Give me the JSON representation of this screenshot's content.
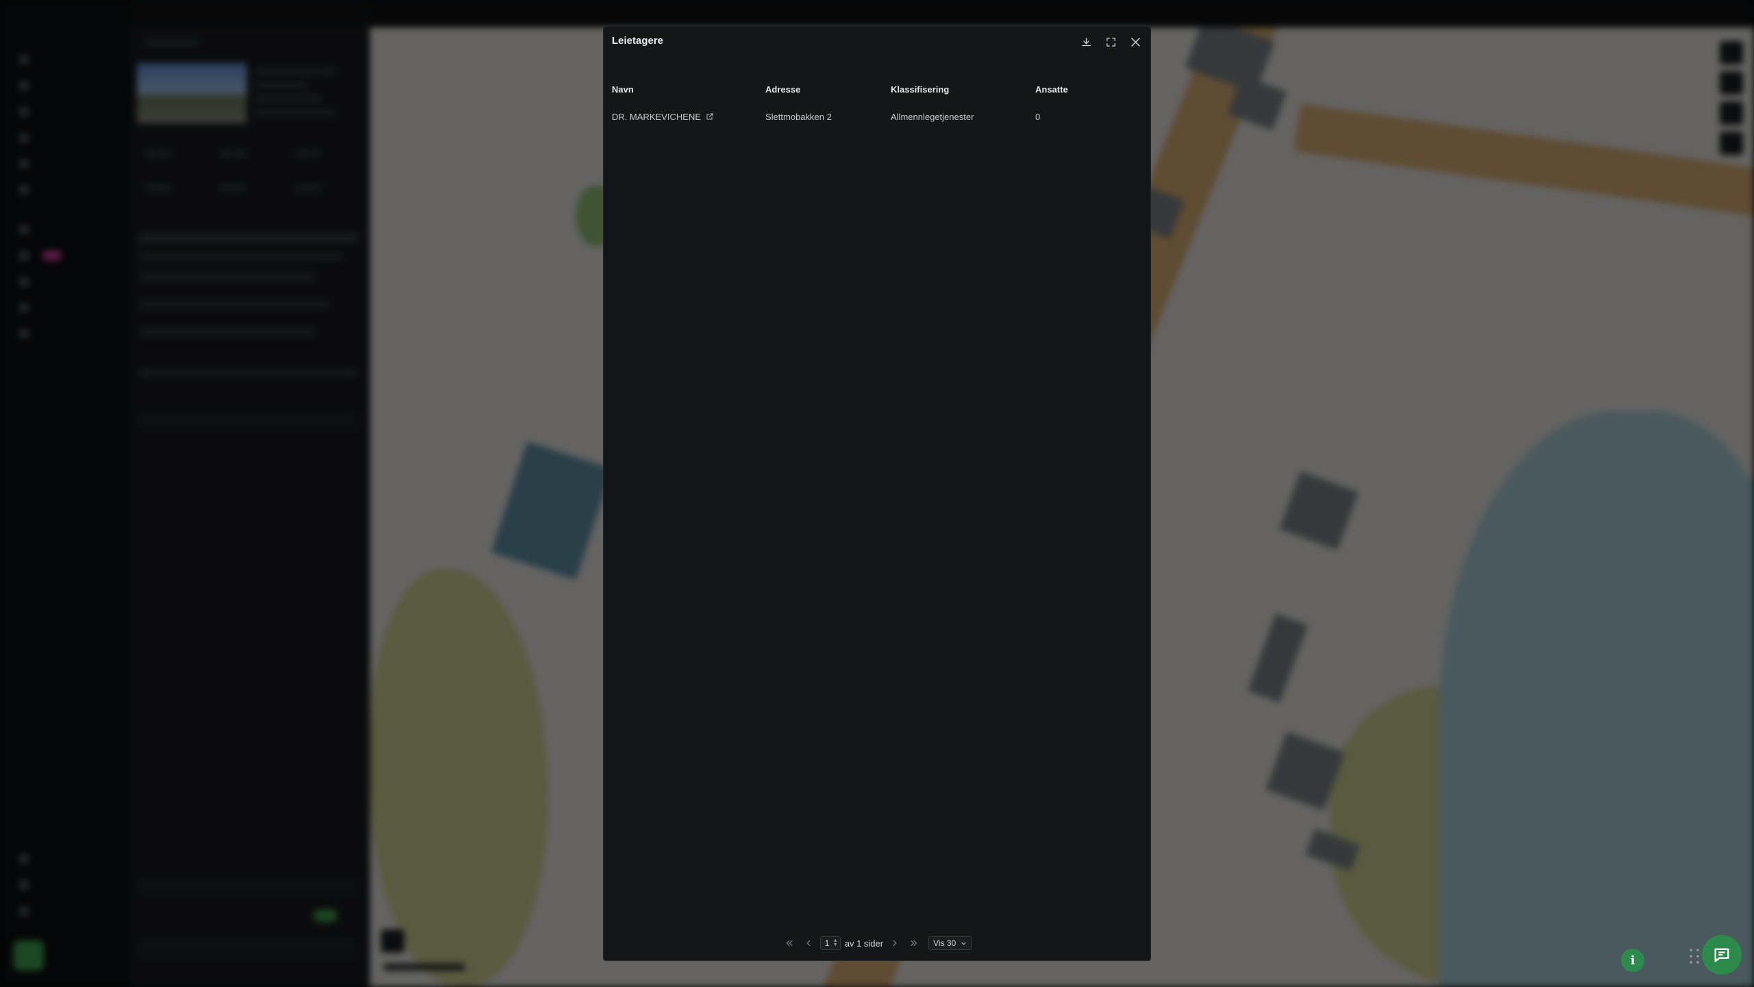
{
  "modal": {
    "title": "Leietagere",
    "columns": [
      "Navn",
      "Adresse",
      "Klassifisering",
      "Ansatte"
    ],
    "rows": [
      {
        "name": "DR. MARKEVICHENE",
        "address": "Slettmobakken 2",
        "classification": "Allmennlegetjenester",
        "employees": "0"
      }
    ],
    "actions": {
      "download_icon": "download-icon",
      "expand_icon": "expand-icon",
      "close_icon": "close-icon"
    }
  },
  "pagination": {
    "current_page": "1",
    "of_pages": "av 1 sider",
    "page_size": "Vis 30"
  },
  "floating": {
    "info_label": "i",
    "chat_icon": "chat-icon"
  },
  "colors": {
    "accent": "#2c8a4b",
    "modal_bg": "#151618",
    "map_road": "#d7ac72",
    "water": "#a6cbd4"
  }
}
